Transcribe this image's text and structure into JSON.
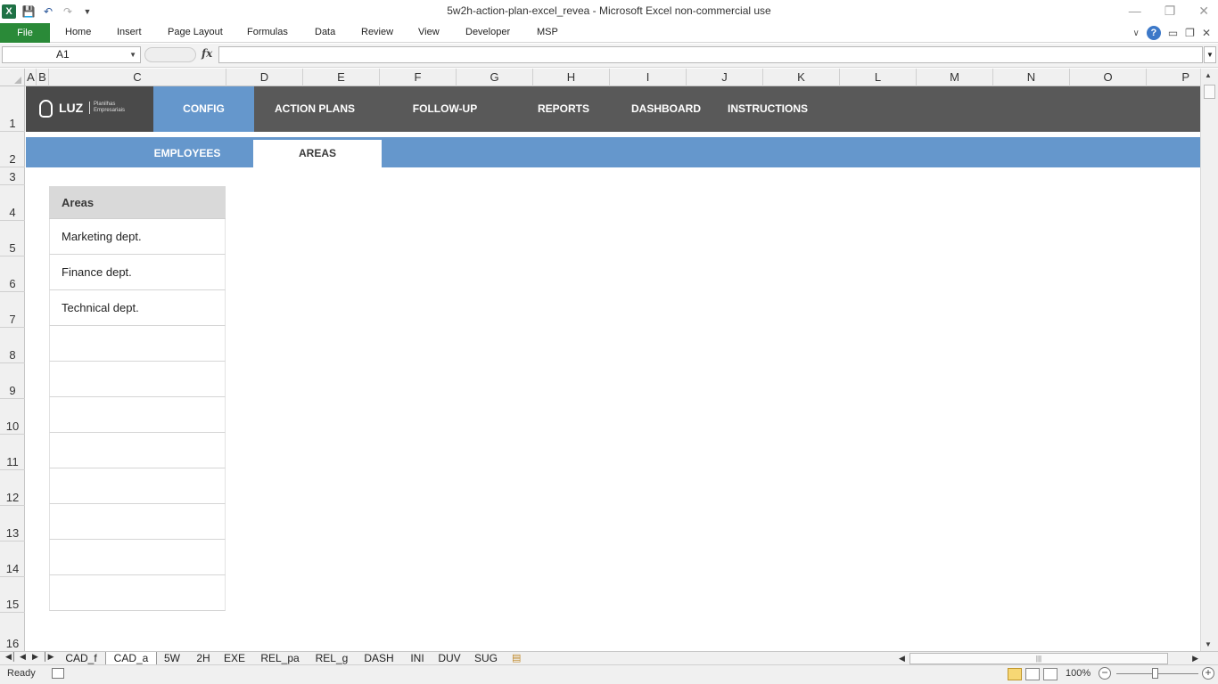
{
  "window": {
    "title": "5w2h-action-plan-excel_revea  -  Microsoft Excel non-commercial use",
    "app_icon": "excel-icon",
    "controls": [
      "minimize-icon",
      "restore-icon",
      "close-icon"
    ]
  },
  "ribbon": {
    "file_label": "File",
    "tabs": [
      "Home",
      "Insert",
      "Page Layout",
      "Formulas",
      "Data",
      "Review",
      "View",
      "Developer",
      "MSP"
    ],
    "file_color": "#2a8a38"
  },
  "formula_bar": {
    "name_box": "A1",
    "fx_label": "fx",
    "formula": ""
  },
  "columns": [
    "A",
    "B",
    "C",
    "D",
    "E",
    "F",
    "G",
    "H",
    "I",
    "J",
    "K",
    "L",
    "M",
    "N",
    "O",
    "P"
  ],
  "rows": [
    "1",
    "2",
    "3",
    "4",
    "5",
    "6",
    "7",
    "8",
    "9",
    "10",
    "11",
    "12",
    "13",
    "14",
    "15",
    "16"
  ],
  "navbar": {
    "logo": {
      "text": "LUZ",
      "tagline": "Planilhas Empresariais"
    },
    "items": [
      "CONFIG",
      "ACTION PLANS",
      "FOLLOW-UP",
      "REPORTS",
      "DASHBOARD",
      "INSTRUCTIONS"
    ],
    "active": "CONFIG",
    "bar_color": "#595959",
    "accent_color": "#6597cc"
  },
  "subnav": {
    "items": [
      "EMPLOYEES",
      "AREAS"
    ],
    "active": "AREAS"
  },
  "areas_table": {
    "header": "Areas",
    "rows": [
      "Marketing dept.",
      "Finance dept.",
      "Technical dept.",
      "",
      "",
      "",
      "",
      "",
      "",
      "",
      ""
    ]
  },
  "sheet_tabs": {
    "tabs": [
      "CAD_f",
      "CAD_a",
      "5W",
      "2H",
      "EXE",
      "REL_pa",
      "REL_g",
      "DASH",
      "INI",
      "DUV",
      "SUG"
    ],
    "active": "CAD_a"
  },
  "status_bar": {
    "status": "Ready",
    "zoom": "100%"
  }
}
